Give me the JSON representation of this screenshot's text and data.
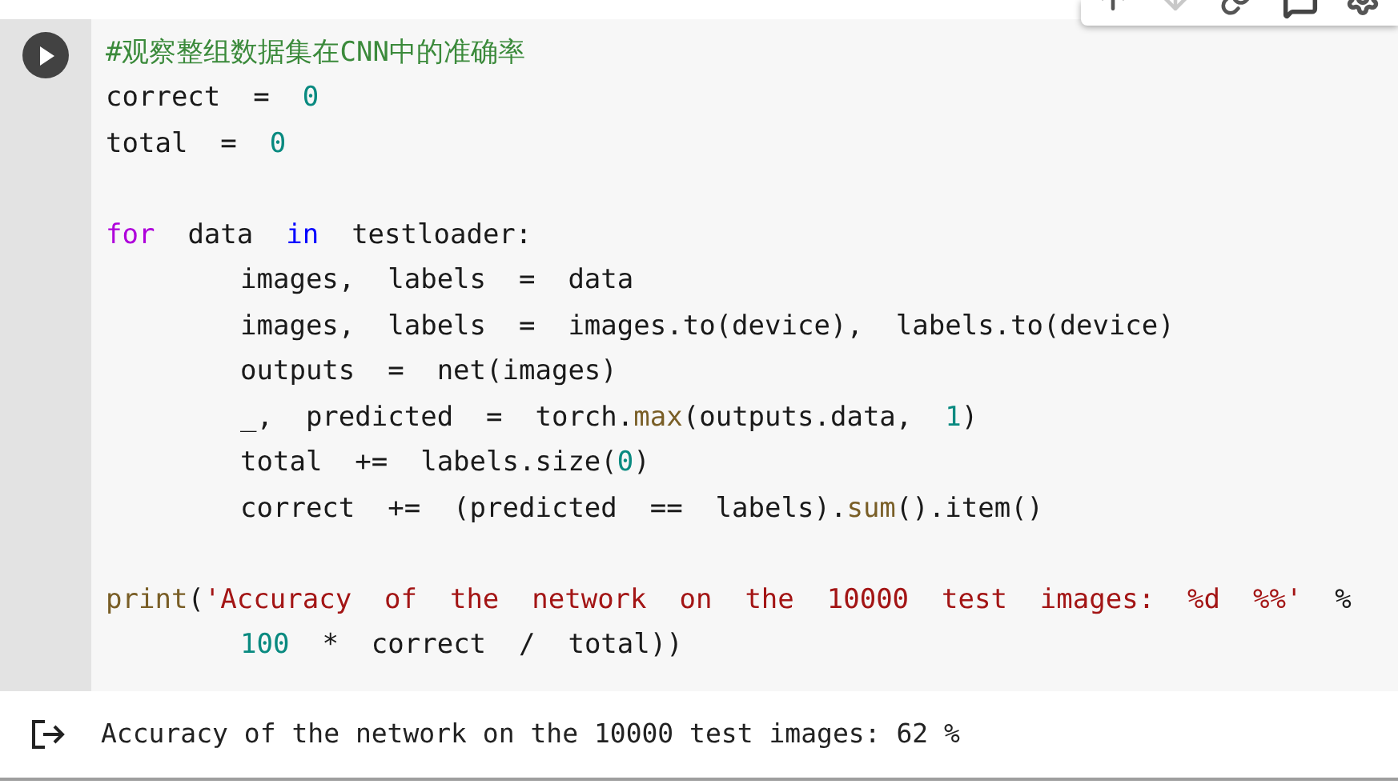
{
  "cell": {
    "lines": [
      {
        "kind": "code",
        "tokens": [
          {
            "kind": "comment",
            "text": "#观察整组数据集在CNN中的准确率"
          }
        ]
      },
      {
        "kind": "code",
        "tokens": [
          {
            "kind": "plain",
            "text": "correct  =  "
          },
          {
            "kind": "number",
            "text": "0"
          }
        ]
      },
      {
        "kind": "code",
        "tokens": [
          {
            "kind": "plain",
            "text": "total  =  "
          },
          {
            "kind": "number",
            "text": "0"
          }
        ]
      },
      {
        "kind": "blank"
      },
      {
        "kind": "code",
        "tokens": [
          {
            "kind": "keyword",
            "text": "for"
          },
          {
            "kind": "plain",
            "text": "  data  "
          },
          {
            "kind": "operator",
            "text": "in"
          },
          {
            "kind": "plain",
            "text": "  testloader:"
          }
        ]
      },
      {
        "kind": "indented",
        "tokens": [
          {
            "kind": "plain",
            "text": "images,  labels  =  data"
          }
        ]
      },
      {
        "kind": "indented",
        "tokens": [
          {
            "kind": "plain",
            "text": "images,  labels  =  images.to(device),  labels.to(device)"
          }
        ]
      },
      {
        "kind": "indented",
        "tokens": [
          {
            "kind": "plain",
            "text": "outputs  =  net(images)"
          }
        ]
      },
      {
        "kind": "indented",
        "tokens": [
          {
            "kind": "plain",
            "text": "_,  predicted  =  torch."
          },
          {
            "kind": "builtin",
            "text": "max"
          },
          {
            "kind": "plain",
            "text": "(outputs.data,  "
          },
          {
            "kind": "number",
            "text": "1"
          },
          {
            "kind": "plain",
            "text": ")"
          }
        ]
      },
      {
        "kind": "indented",
        "tokens": [
          {
            "kind": "plain",
            "text": "total  +=  labels.size("
          },
          {
            "kind": "number",
            "text": "0"
          },
          {
            "kind": "plain",
            "text": ")"
          }
        ]
      },
      {
        "kind": "indented",
        "tokens": [
          {
            "kind": "plain",
            "text": "correct  +=  (predicted  ==  labels)."
          },
          {
            "kind": "builtin",
            "text": "sum"
          },
          {
            "kind": "plain",
            "text": "().item()"
          }
        ]
      },
      {
        "kind": "blank"
      },
      {
        "kind": "code",
        "tokens": [
          {
            "kind": "builtin",
            "text": "print"
          },
          {
            "kind": "plain",
            "text": "("
          },
          {
            "kind": "string",
            "text": "'Accuracy  of  the  network  on  the  10000  test  images:  %d  %%'"
          },
          {
            "kind": "plain",
            "text": "  %"
          }
        ]
      },
      {
        "kind": "indented",
        "tokens": [
          {
            "kind": "number",
            "text": "100"
          },
          {
            "kind": "plain",
            "text": "  *  correct  /  total))"
          }
        ]
      }
    ]
  },
  "output": {
    "text": "Accuracy of the network on the 10000 test images: 62 %"
  }
}
